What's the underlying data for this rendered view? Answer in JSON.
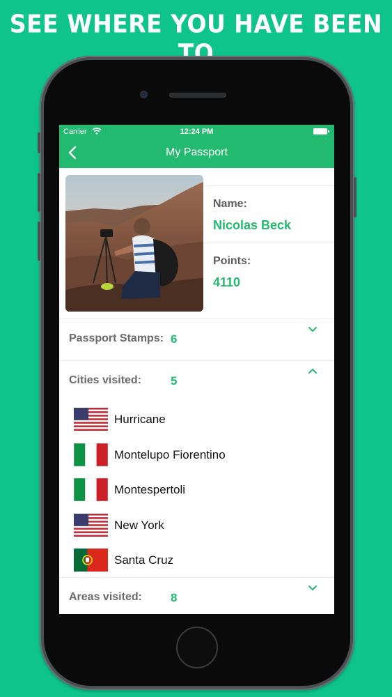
{
  "headline": "SEE WHERE YOU HAVE BEEN TO",
  "status_bar": {
    "carrier": "Carrier",
    "time": "12:24 PM"
  },
  "nav": {
    "title": "My Passport",
    "back_icon": "chevron-left-icon"
  },
  "profile": {
    "name_label": "Name:",
    "name_value": "Nicolas Beck",
    "points_label": "Points:",
    "points_value": "4110"
  },
  "sections": [
    {
      "label": "Passport Stamps:",
      "count": "6",
      "expanded": false
    },
    {
      "label": "Cities visited:",
      "count": "5",
      "expanded": true
    },
    {
      "label": "Areas visited:",
      "count": "8",
      "expanded": false
    }
  ],
  "cities": [
    {
      "name": "Hurricane",
      "flag": "us-flag-icon"
    },
    {
      "name": "Montelupo Fiorentino",
      "flag": "it-flag-icon"
    },
    {
      "name": "Montespertoli",
      "flag": "it-flag-icon"
    },
    {
      "name": "New York",
      "flag": "us-flag-icon"
    },
    {
      "name": "Santa Cruz",
      "flag": "pt-flag-icon"
    }
  ],
  "colors": {
    "background": "#0fc48b",
    "accent": "#22ba6e",
    "label": "#6a6a6a"
  }
}
